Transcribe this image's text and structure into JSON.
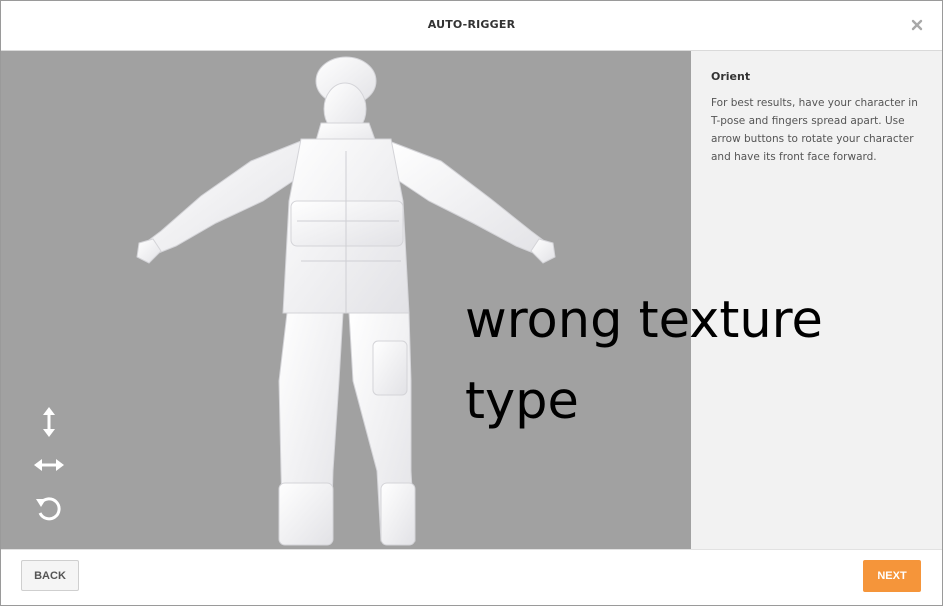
{
  "header": {
    "title": "AUTO-RIGGER",
    "close_icon": "close-icon"
  },
  "viewport": {
    "background": "#a1a1a1",
    "controls": [
      {
        "name": "move-vertical-icon"
      },
      {
        "name": "move-horizontal-icon"
      },
      {
        "name": "rotate-icon"
      }
    ],
    "overlay_text": "wrong texture type"
  },
  "panel": {
    "heading": "Orient",
    "body": "For best results, have your character in T-pose and fingers spread apart. Use arrow buttons to rotate your character and have its front face forward."
  },
  "footer": {
    "back_label": "BACK",
    "next_label": "NEXT",
    "next_color": "#f5953a"
  }
}
